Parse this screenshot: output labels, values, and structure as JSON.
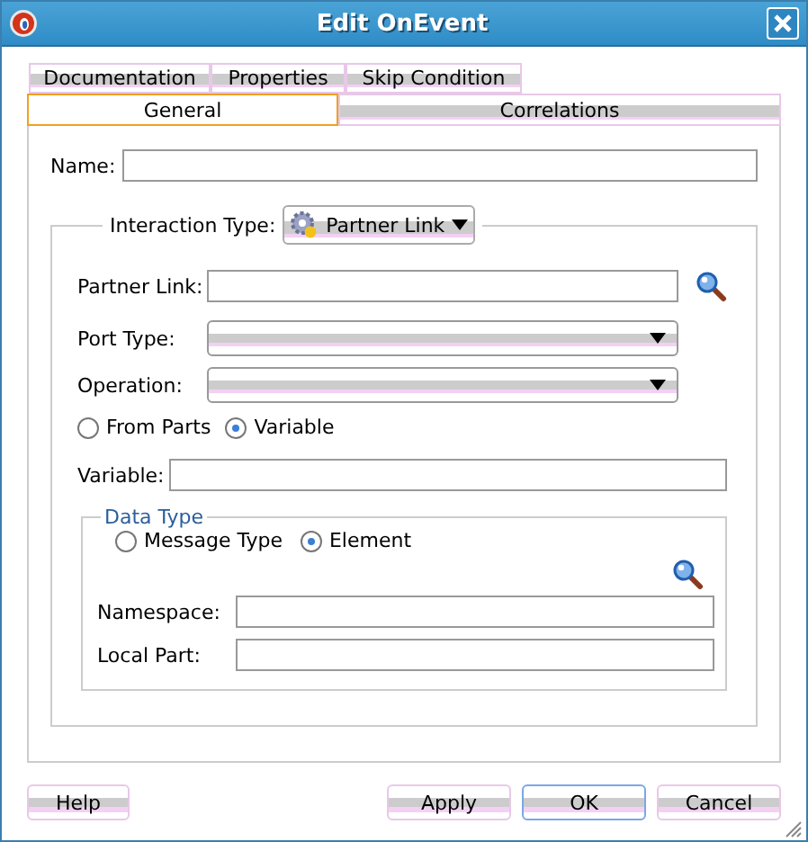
{
  "window": {
    "title": "Edit OnEvent"
  },
  "tabs_row_1": [
    {
      "label": "Documentation",
      "selected": false
    },
    {
      "label": "Properties",
      "selected": false
    },
    {
      "label": "Skip Condition",
      "selected": false
    }
  ],
  "tabs_row_2": [
    {
      "label": "General",
      "selected": true
    },
    {
      "label": "Correlations",
      "selected": false
    }
  ],
  "name_field": {
    "label": "Name:"
  },
  "interaction_type": {
    "label": "Interaction Type:",
    "value": "Partner Link"
  },
  "partner_link": {
    "label": "Partner Link:"
  },
  "port_type": {
    "label": "Port Type:"
  },
  "operation": {
    "label": "Operation:"
  },
  "source_options": [
    {
      "label": "From Parts",
      "selected": false
    },
    {
      "label": "Variable",
      "selected": true
    }
  ],
  "variable": {
    "label": "Variable:"
  },
  "data_type": {
    "title": "Data Type",
    "options": [
      {
        "label": "Message Type",
        "selected": false
      },
      {
        "label": "Element",
        "selected": true
      }
    ],
    "namespace": {
      "label": "Namespace:"
    },
    "local_part": {
      "label": "Local Part:"
    }
  },
  "buttons_left": [
    {
      "label": "Help",
      "default": false
    }
  ],
  "buttons_right": [
    {
      "label": "Apply",
      "default": false
    },
    {
      "label": "OK",
      "default": true
    },
    {
      "label": "Cancel",
      "default": false
    }
  ]
}
